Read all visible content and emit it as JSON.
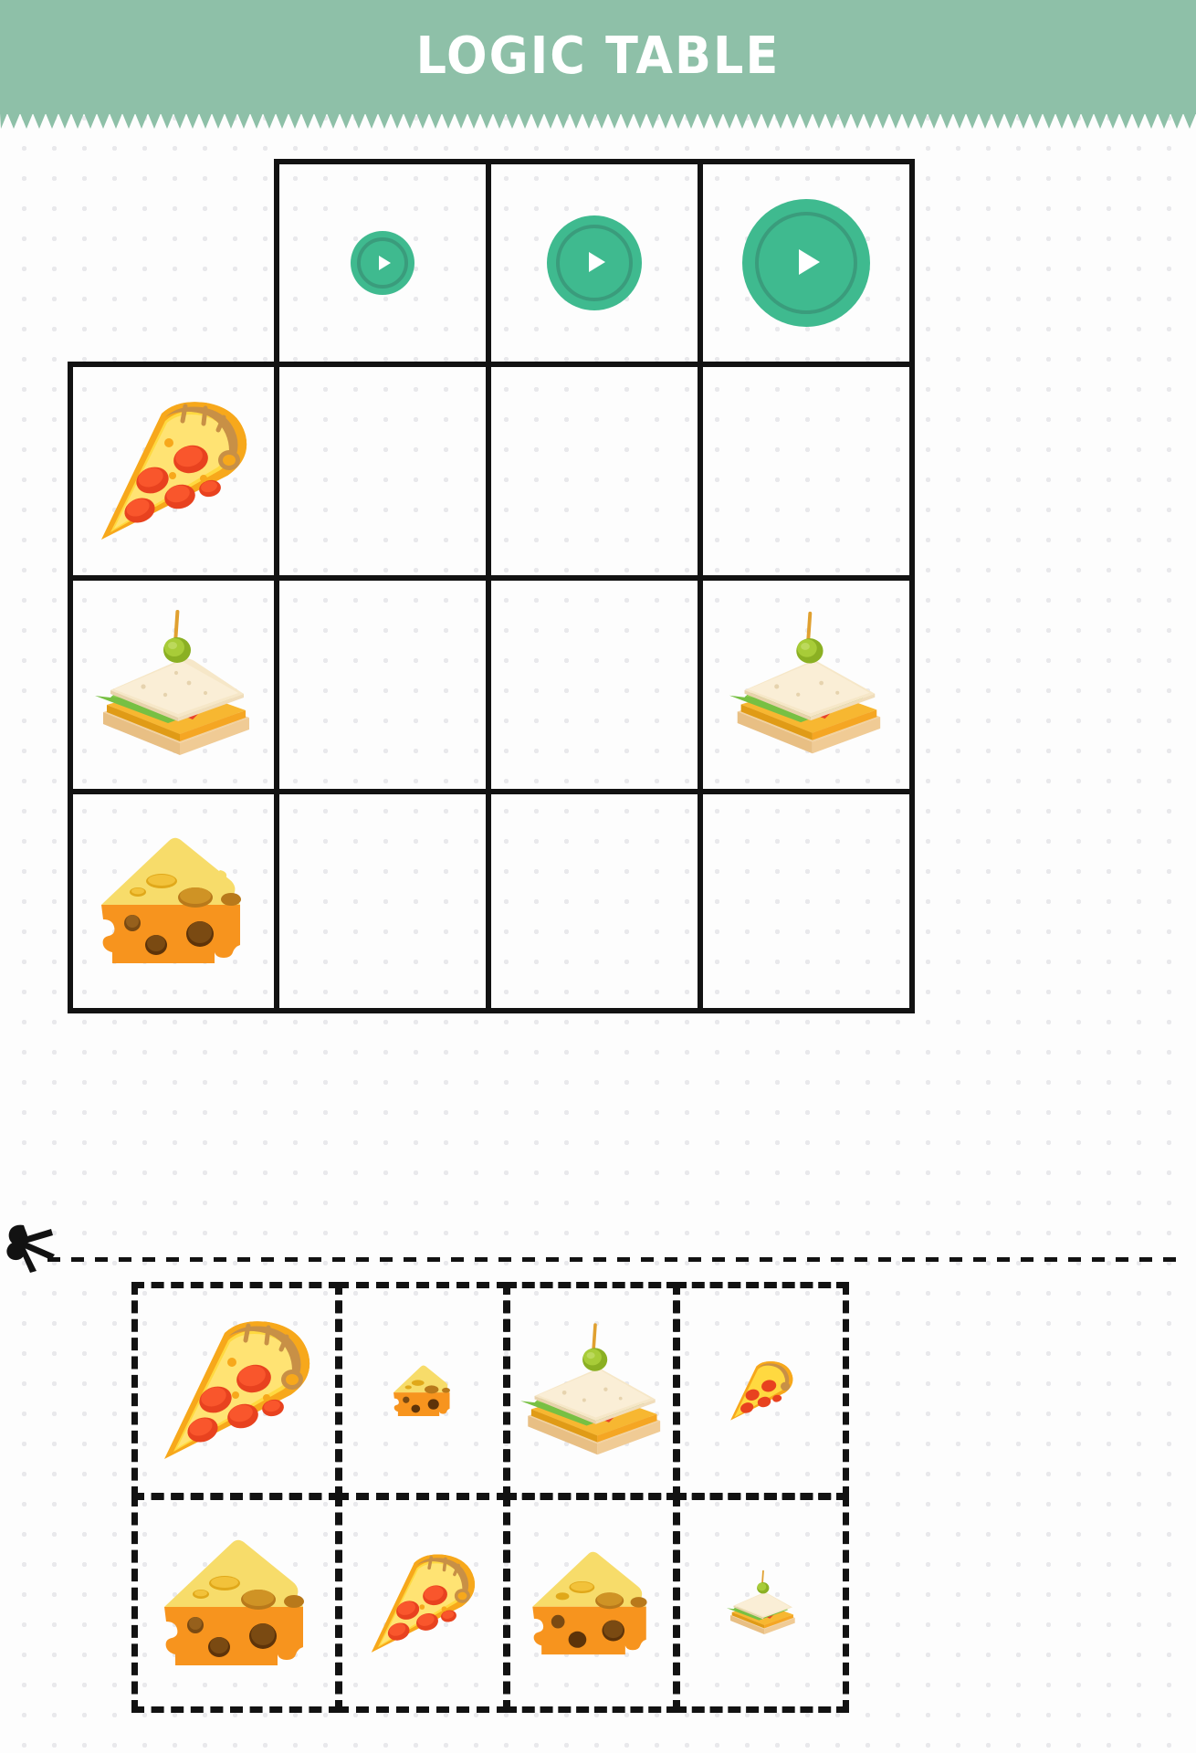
{
  "page": {
    "title": "LOGIC TABLE",
    "worksheet_type": "logic table matching worksheet",
    "theme": "food",
    "background": "#fdfdfd",
    "dot_color": "#e9e9ec"
  },
  "header": {
    "title": "LOGIC TABLE",
    "background_color": "#8ec0a8",
    "text_color": "#ffffff",
    "edge": "zigzag"
  },
  "colors": {
    "accent_green": "#8ec0a8",
    "circle_green": "#3fba8f",
    "circle_ring": "#3a9c7c",
    "grid_line": "#121212",
    "pizza_crust": "#f5a623",
    "pizza_crust_dark": "#c08a3e",
    "pizza_cheese": "#ffd94a",
    "pizza_cheese_light": "#ffe87a",
    "pepperoni": "#f04b27",
    "pepperoni_dark": "#d9371a",
    "cheese_top": "#f7dc6a",
    "cheese_side": "#f7941e",
    "cheese_hole": "#8a5a1e",
    "bread_top": "#f6e7c8",
    "bread_crust": "#f5c98a",
    "lettuce": "#77c043",
    "tomato": "#e8432a",
    "olive": "#9cc12c",
    "toothpick": "#e0a030"
  },
  "grid": {
    "column_header_label": "size",
    "columns": [
      {
        "index": 0,
        "name": "small",
        "icon": "circle-size-small",
        "diameter": 70
      },
      {
        "index": 1,
        "name": "medium",
        "icon": "circle-size-medium",
        "diameter": 104
      },
      {
        "index": 2,
        "name": "large",
        "icon": "circle-size-large",
        "diameter": 140
      }
    ],
    "rows": [
      {
        "index": 0,
        "name": "pizza",
        "icon": "pizza-slice"
      },
      {
        "index": 1,
        "name": "sandwich",
        "icon": "sandwich"
      },
      {
        "index": 2,
        "name": "cheese",
        "icon": "cheese-wedge"
      }
    ],
    "cells": [
      {
        "row": 0,
        "col": 0,
        "content": null
      },
      {
        "row": 0,
        "col": 1,
        "content": null
      },
      {
        "row": 0,
        "col": 2,
        "content": null
      },
      {
        "row": 1,
        "col": 0,
        "content": null
      },
      {
        "row": 1,
        "col": 1,
        "content": null
      },
      {
        "row": 1,
        "col": 2,
        "content": "sandwich-large"
      },
      {
        "row": 2,
        "col": 0,
        "content": null
      },
      {
        "row": 2,
        "col": 1,
        "content": null
      },
      {
        "row": 2,
        "col": 2,
        "content": null
      }
    ],
    "filled_count": 1,
    "empty_count": 8
  },
  "cut_section": {
    "cut_icon": "scissors-icon",
    "cut_line_style": "dashed",
    "pieces": [
      {
        "index": 0,
        "row": 0,
        "col": 0,
        "item": "pizza-slice",
        "size": "large"
      },
      {
        "index": 1,
        "row": 0,
        "col": 1,
        "item": "cheese-wedge",
        "size": "small"
      },
      {
        "index": 2,
        "row": 0,
        "col": 2,
        "item": "sandwich",
        "size": "large"
      },
      {
        "index": 3,
        "row": 0,
        "col": 3,
        "item": "pizza-slice",
        "size": "small"
      },
      {
        "index": 4,
        "row": 1,
        "col": 0,
        "item": "cheese-wedge",
        "size": "large"
      },
      {
        "index": 5,
        "row": 1,
        "col": 1,
        "item": "pizza-slice",
        "size": "medium"
      },
      {
        "index": 6,
        "row": 1,
        "col": 2,
        "item": "cheese-wedge",
        "size": "medium"
      },
      {
        "index": 7,
        "row": 1,
        "col": 3,
        "item": "sandwich",
        "size": "small"
      }
    ]
  }
}
